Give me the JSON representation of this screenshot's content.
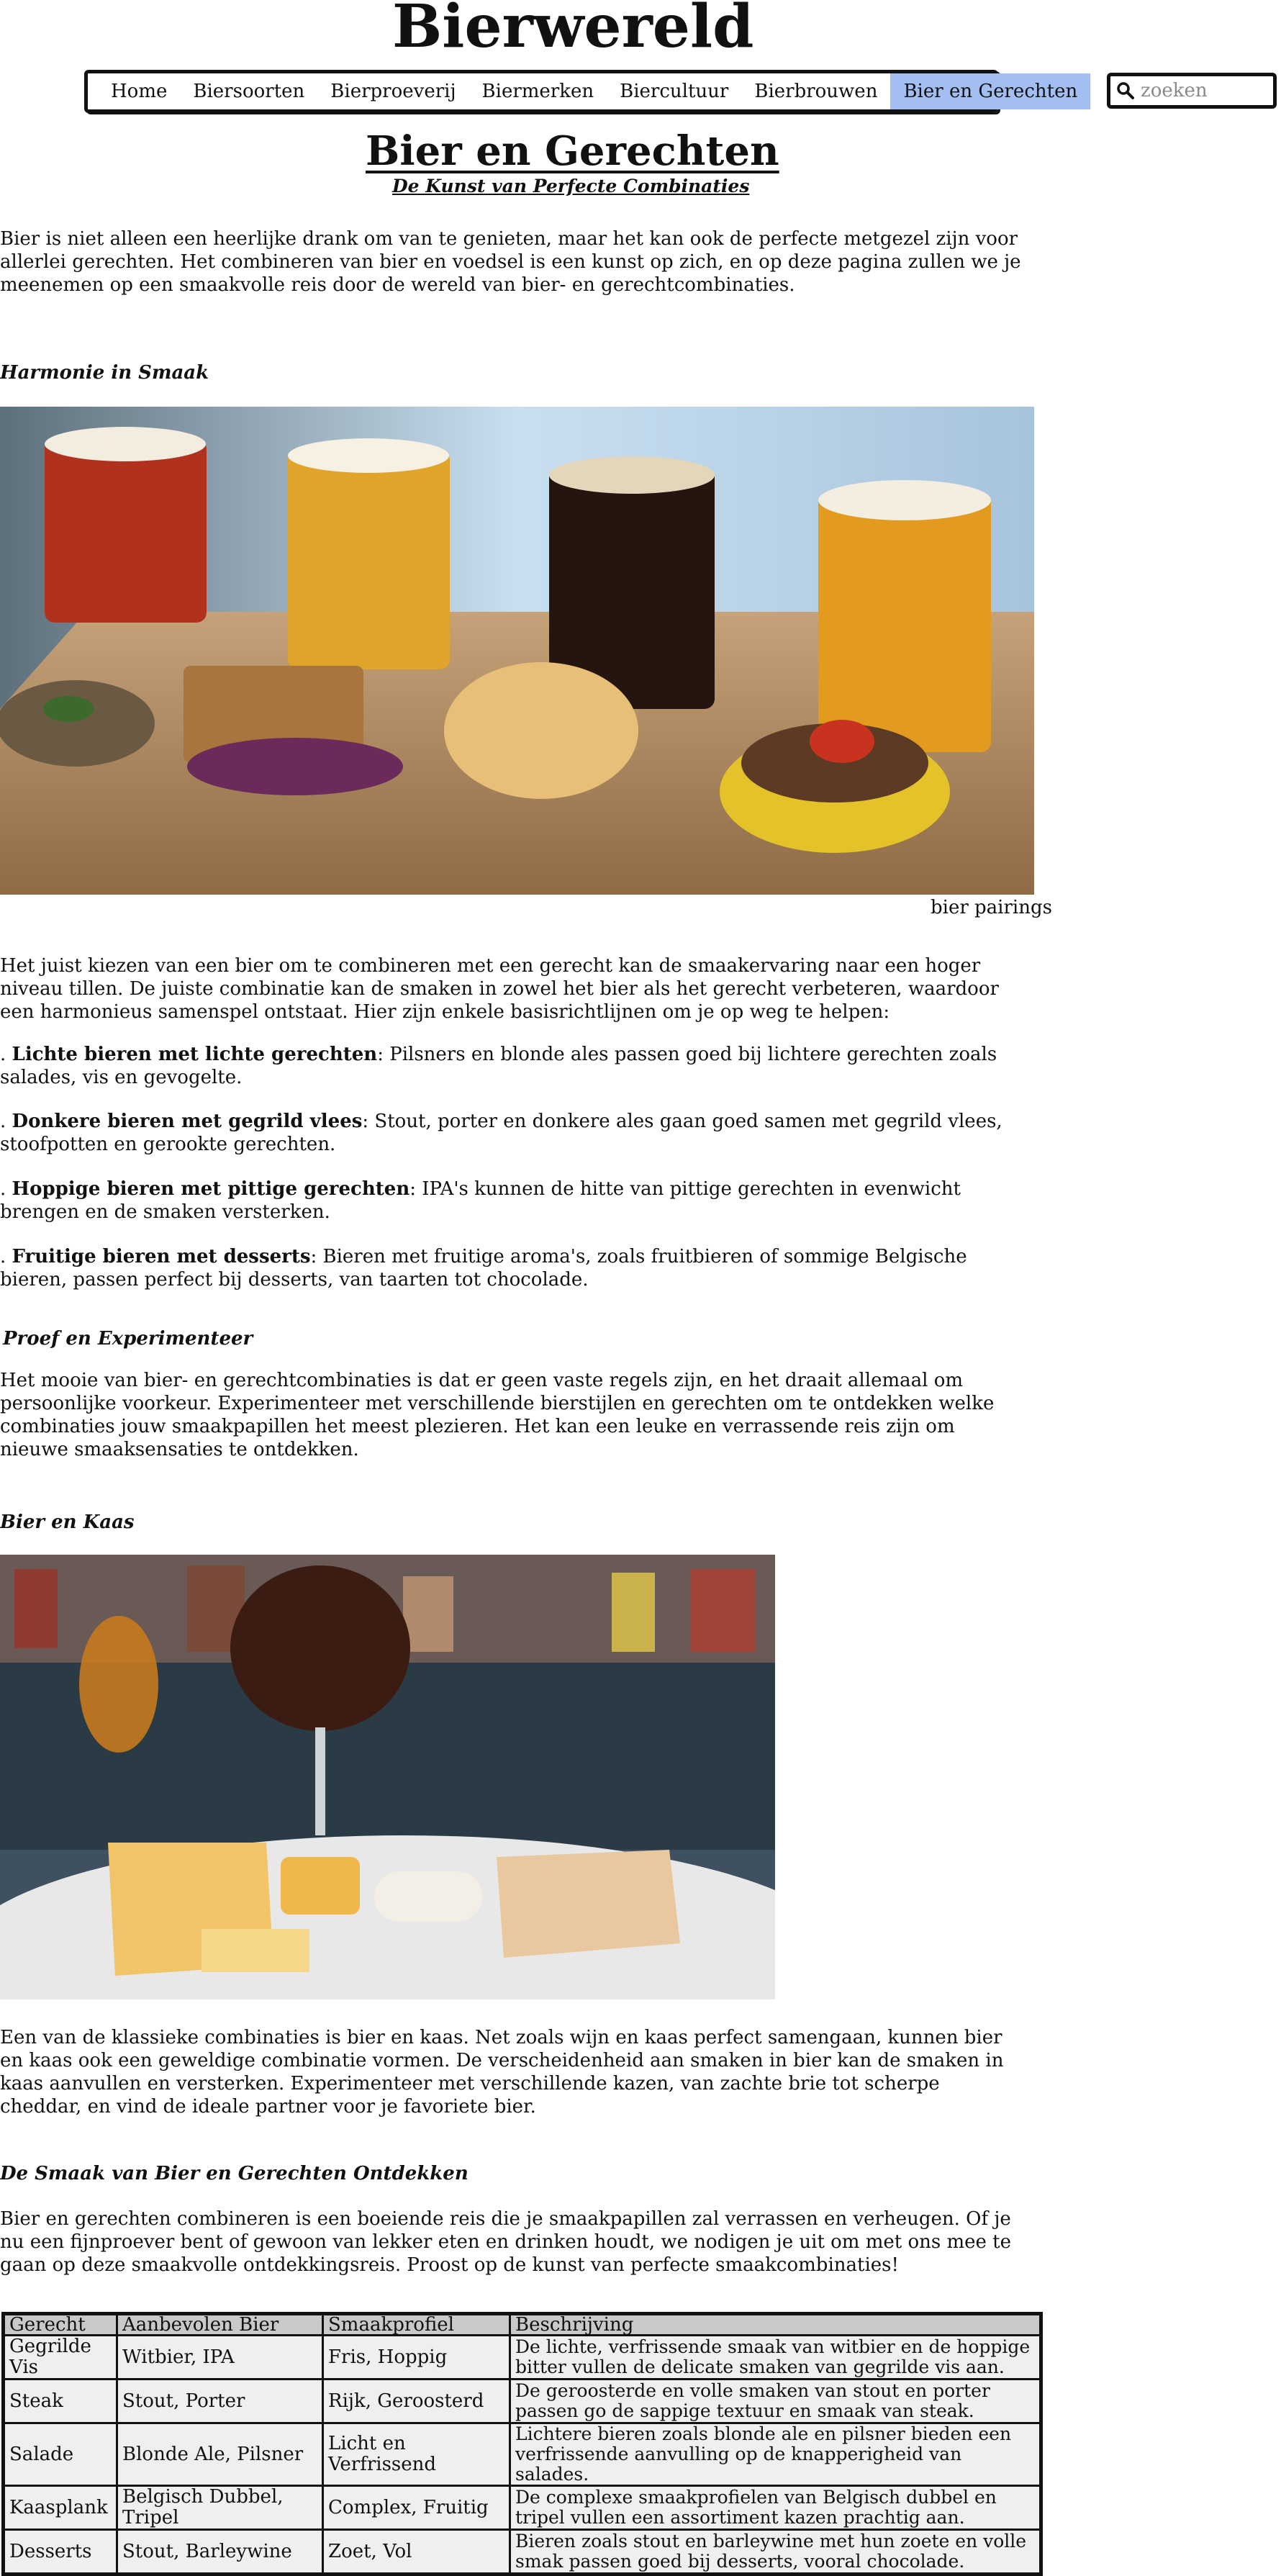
{
  "site": {
    "title": "Bierwereld"
  },
  "nav": {
    "items": [
      "Home",
      "Biersoorten",
      "Bierproeverij",
      "Biermerken",
      "Biercultuur",
      "Bierbrouwen",
      "Bier en Gerechten"
    ],
    "active_index": 6
  },
  "search": {
    "placeholder": "zoeken"
  },
  "page": {
    "heading": "Bier en Gerechten",
    "subheading": "De Kunst van Perfecte Combinaties"
  },
  "intro": "Bier is niet alleen een heerlijke drank om van te genieten, maar het kan ook de perfecte metgezel zijn voor allerlei gerechten. Het combineren van bier en voedsel is een kunst op zich, en op deze pagina zullen we je meenemen op een smaakvolle reis door de wereld van bier- en gerechtcombinaties.",
  "harmonie": {
    "title": "Harmonie in Smaak",
    "caption": "bier pairings",
    "text": "Het juist kiezen van een bier om te combineren met een gerecht kan de smaakervaring naar een hoger niveau tillen. De juiste combinatie kan de smaken in zowel het bier als het gerecht verbeteren, waardoor een harmonieus samenspel ontstaat. Hier zijn enkele basisrichtlijnen om je op weg te helpen:",
    "tips": [
      {
        "prefix": ". ",
        "bold": "Lichte bieren met lichte gerechten",
        "rest": ": Pilsners en blonde ales passen goed bij lichtere gerechten zoals salades, vis en gevogelte."
      },
      {
        "prefix": ". ",
        "bold": "Donkere bieren met gegrild vlees",
        "rest": ": Stout, porter en donkere ales gaan goed samen met gegrild vlees, stoofpotten en gerookte gerechten."
      },
      {
        "prefix": ". ",
        "bold": "Hoppige bieren met pittige gerechten",
        "rest": ": IPA's kunnen de hitte van pittige gerechten in evenwicht brengen en de smaken versterken."
      },
      {
        "prefix": ". ",
        "bold": "Fruitige bieren met desserts",
        "rest": ": Bieren met fruitige aroma's, zoals fruitbieren of sommige Belgische bieren, passen perfect bij desserts, van taarten tot chocolade."
      }
    ]
  },
  "proef": {
    "title": "Proef en Experimenteer",
    "text": "Het mooie van bier- en gerechtcombinaties is dat er geen vaste regels zijn, en het draait allemaal om persoonlijke voorkeur. Experimenteer met verschillende bierstijlen en gerechten om te ontdekken welke combinaties jouw smaakpapillen het meest plezieren. Het kan een leuke en verrassende reis zijn om nieuwe smaaksensaties te ontdekken."
  },
  "kaas": {
    "title": "Bier en Kaas",
    "text": "Een van de klassieke combinaties is bier en kaas. Net zoals wijn en kaas perfect samengaan, kunnen bier en kaas ook een geweldige combinatie vormen. De verscheidenheid aan smaken in bier kan de smaken in kaas aanvullen en versterken. Experimenteer met verschillende kazen, van zachte brie tot scherpe cheddar, en vind de ideale partner voor je favoriete bier."
  },
  "ontdekken": {
    "title": "De Smaak van Bier en Gerechten Ontdekken",
    "text": "Bier en gerechten combineren is een boeiende reis die je smaakpapillen zal verrassen en verheugen. Of je nu een fijnproever bent of gewoon van lekker eten en drinken houdt, we nodigen je uit om met ons mee te gaan op deze smaakvolle ontdekkingsreis. Proost op de kunst van perfecte smaakcombinaties!"
  },
  "table": {
    "headers": [
      "Gerecht",
      "Aanbevolen Bier",
      "Smaakprofiel",
      "Beschrijving"
    ],
    "rows": [
      [
        "Gegrilde Vis",
        "Witbier, IPA",
        "Fris, Hoppig",
        "De lichte, verfrissende smaak van witbier en de hoppige bitter vullen de delicate smaken van gegrilde vis aan."
      ],
      [
        "Steak",
        "Stout, Porter",
        "Rijk, Geroosterd",
        "De geroosterde en volle smaken van stout en porter passen go de sappige textuur en smaak van steak."
      ],
      [
        "Salade",
        "Blonde Ale, Pilsner",
        "Licht en Verfrissend",
        "Lichtere bieren zoals blonde ale en pilsner bieden een verfrissende aanvulling op de knapperigheid van salades."
      ],
      [
        "Kaasplank",
        "Belgisch Dubbel, Tripel",
        "Complex, Fruitig",
        "De complexe smaakprofielen van Belgisch dubbel en tripel vullen een assortiment kazen prachtig aan."
      ],
      [
        "Desserts",
        "Stout, Barleywine",
        "Zoet, Vol",
        "Bieren zoals stout en barleywine met hun zoete en volle smak passen goed bij desserts, vooral chocolade."
      ]
    ]
  }
}
